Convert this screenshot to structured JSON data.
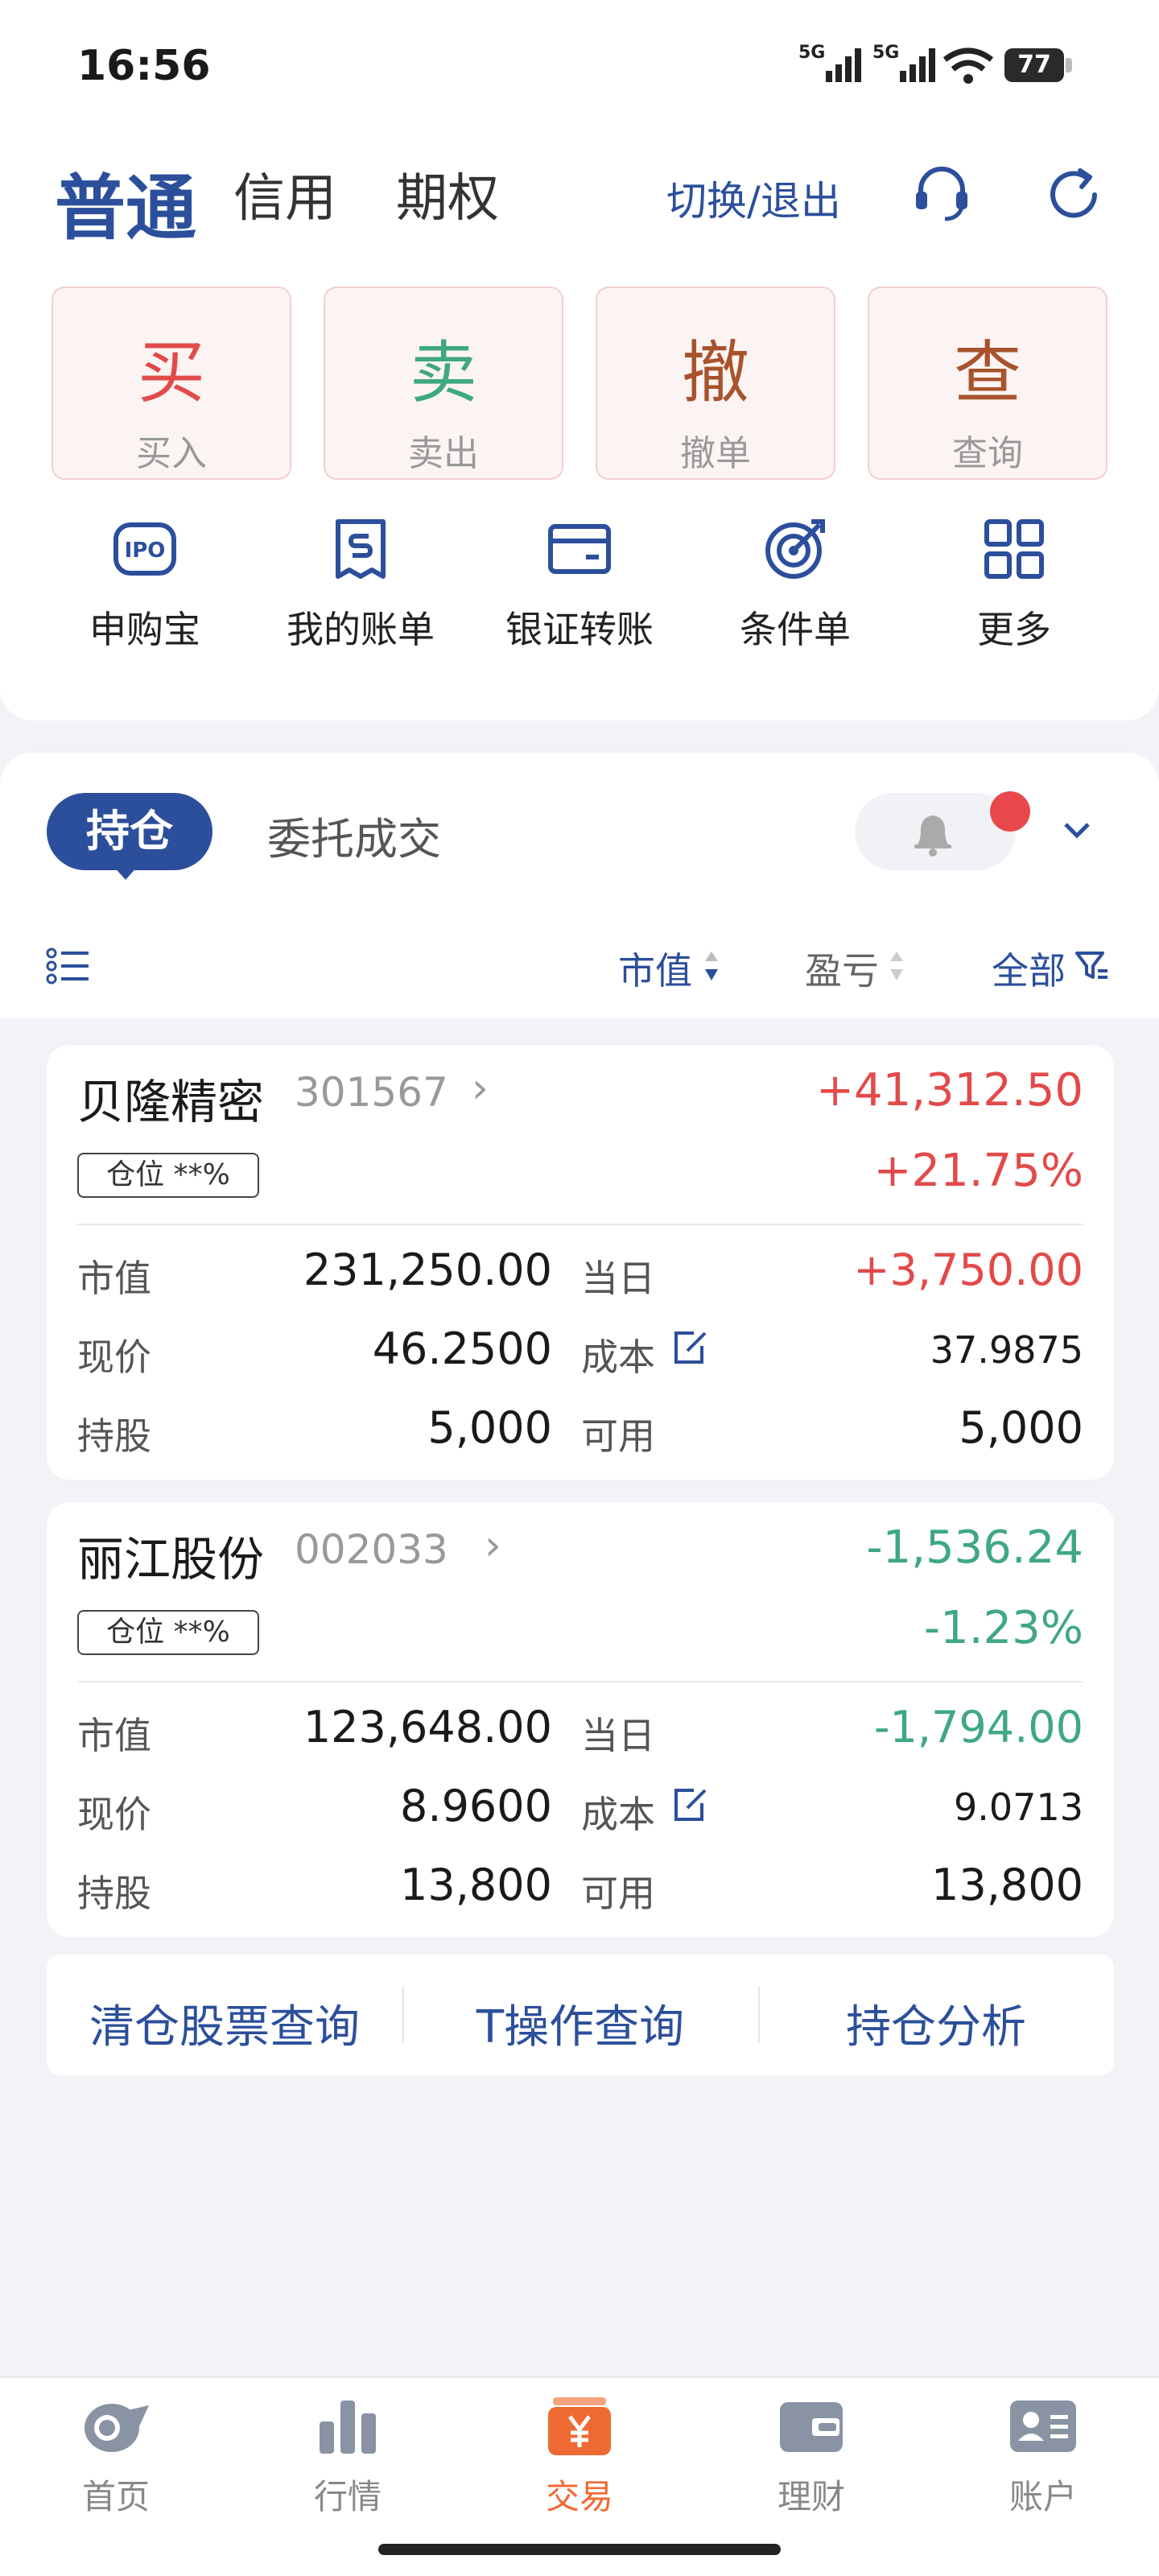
{
  "status": {
    "time": "16:56",
    "net1": "5G",
    "net2": "5G",
    "battery": "77"
  },
  "header": {
    "tabs": [
      "普通",
      "信用",
      "期权"
    ],
    "switch_label": "切换/退出"
  },
  "trade_buttons": [
    {
      "big": "买",
      "small": "买入",
      "color": "#e24a4a"
    },
    {
      "big": "卖",
      "small": "卖出",
      "color": "#3fa882"
    },
    {
      "big": "撤",
      "small": "撤单",
      "color": "#a8532c"
    },
    {
      "big": "查",
      "small": "查询",
      "color": "#a8532c"
    }
  ],
  "quick_actions": [
    "申购宝",
    "我的账单",
    "银证转账",
    "条件单",
    "更多"
  ],
  "holdings": {
    "tabs": [
      "持仓",
      "委托成交"
    ],
    "sort": {
      "market_value": "市值",
      "profit": "盈亏",
      "all": "全部"
    },
    "ipo_icon_text": "IPO",
    "stocks": [
      {
        "name": "贝隆精密",
        "code": "301567",
        "position": "仓位 **%",
        "pnl": "+41,312.50",
        "pnl_pct": "+21.75%",
        "labels": [
          "市值",
          "现价",
          "持股",
          "当日",
          "成本",
          "可用"
        ],
        "market_value": "231,250.00",
        "price": "46.2500",
        "shares": "5,000",
        "day_pnl": "+3,750.00",
        "cost": "37.9875",
        "available": "5,000"
      },
      {
        "name": "丽江股份",
        "code": "002033",
        "position": "仓位 **%",
        "pnl": "-1,536.24",
        "pnl_pct": "-1.23%",
        "labels": [
          "市值",
          "现价",
          "持股",
          "当日",
          "成本",
          "可用"
        ],
        "market_value": "123,648.00",
        "price": "8.9600",
        "shares": "13,800",
        "day_pnl": "-1,794.00",
        "cost": "9.0713",
        "available": "13,800"
      }
    ],
    "links": [
      "清仓股票查询",
      "T操作查询",
      "持仓分析"
    ]
  },
  "nav": {
    "items": [
      "首页",
      "行情",
      "交易",
      "理财",
      "账户"
    ],
    "active_index": 2,
    "accent": "#ef6a33"
  },
  "colors": {
    "brand": "#2c4f9c",
    "up": "#e24a4a",
    "down": "#3fa882"
  }
}
